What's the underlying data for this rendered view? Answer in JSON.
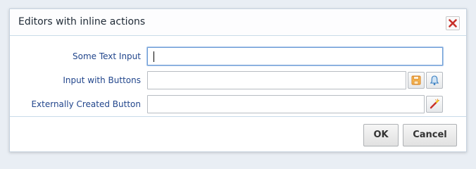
{
  "dialog": {
    "title": "Editors with inline actions",
    "close_icon": "close-icon"
  },
  "fields": [
    {
      "label": "Some Text Input",
      "value": "",
      "placeholder": ""
    },
    {
      "label": "Input with Buttons",
      "value": "",
      "placeholder": "",
      "buttons": [
        "save-icon",
        "bell-icon"
      ]
    },
    {
      "label": "Externally Created Button",
      "value": "",
      "placeholder": "",
      "buttons": [
        "magic-wand-icon"
      ]
    }
  ],
  "footer": {
    "ok_label": "OK",
    "cancel_label": "Cancel"
  },
  "colors": {
    "label_text": "#22468c",
    "close_x": "#c8312a",
    "focus_border": "#6f9ed6",
    "save_icon": "#e8912b",
    "bell_icon": "#3a7fc1"
  }
}
